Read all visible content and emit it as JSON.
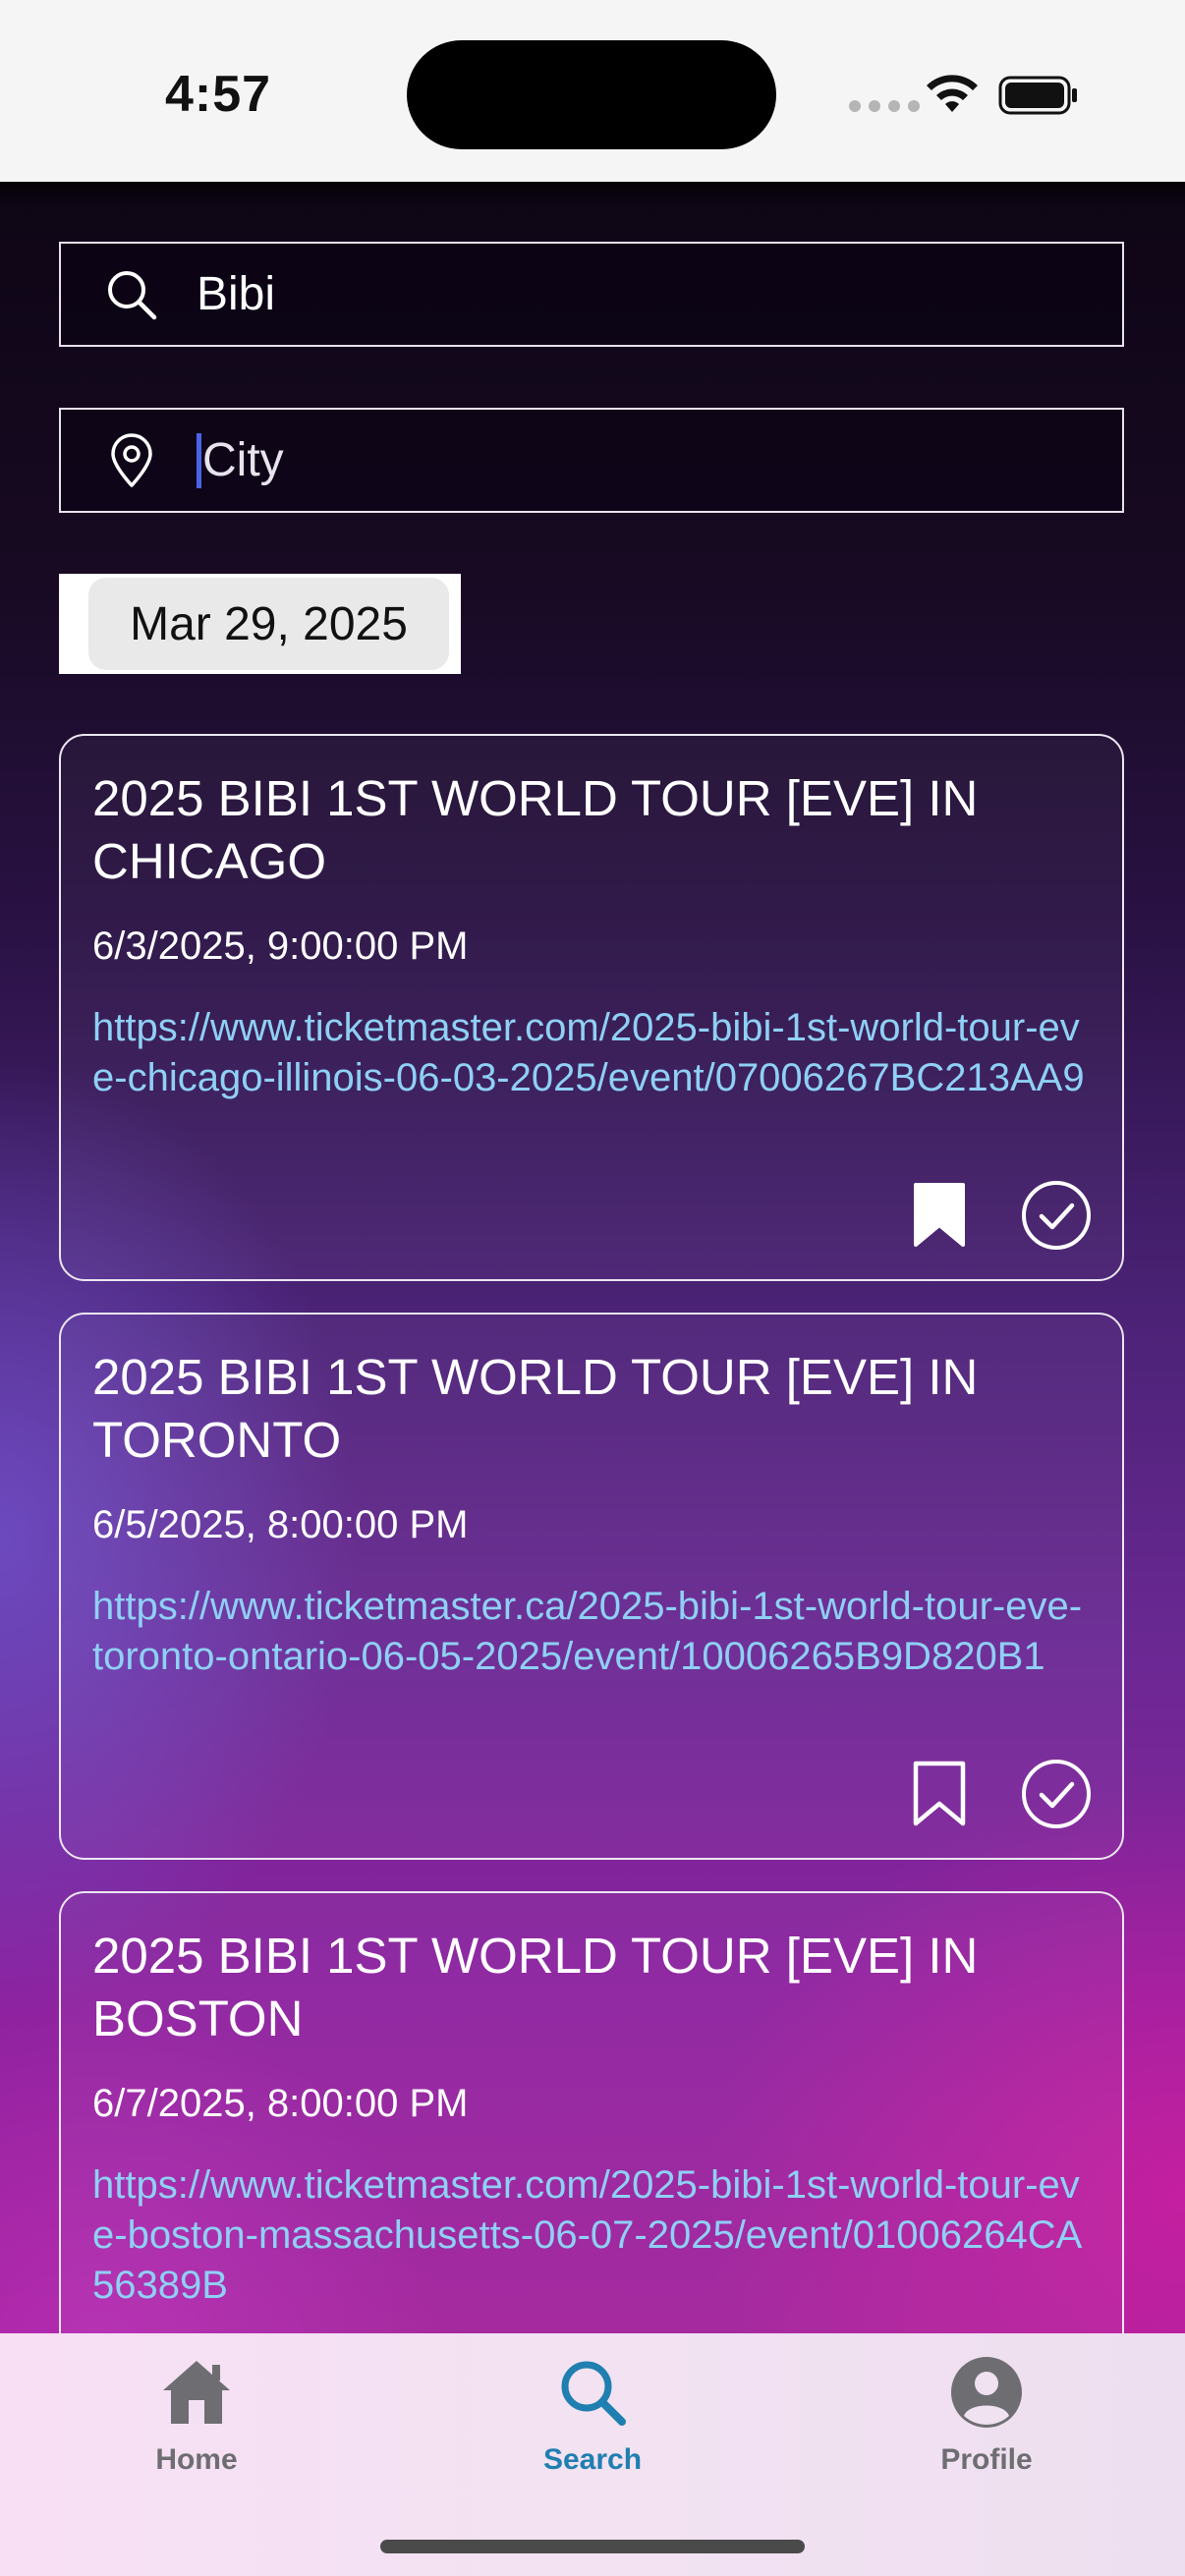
{
  "status_bar": {
    "time": "4:57"
  },
  "search": {
    "query": "Bibi",
    "icon": "search-icon"
  },
  "city": {
    "placeholder": "City",
    "icon": "location-pin-icon"
  },
  "date_picker": {
    "value": "Mar 29, 2025"
  },
  "events": [
    {
      "title": "2025 BIBI 1ST WORLD TOUR [EVE] IN CHICAGO",
      "datetime": "6/3/2025, 9:00:00 PM",
      "url": "https://www.ticketmaster.com/2025-bibi-1st-world-tour-eve-chicago-illinois-06-03-2025/event/07006267BC213AA9",
      "bookmarked": true
    },
    {
      "title": "2025 BIBI 1ST WORLD TOUR [EVE] IN TORONTO",
      "datetime": "6/5/2025, 8:00:00 PM",
      "url": "https://www.ticketmaster.ca/2025-bibi-1st-world-tour-eve-toronto-ontario-06-05-2025/event/10006265B9D820B1",
      "bookmarked": false
    },
    {
      "title": "2025 BIBI 1ST WORLD TOUR [EVE] IN BOSTON",
      "datetime": "6/7/2025, 8:00:00 PM",
      "url": "https://www.ticketmaster.com/2025-bibi-1st-world-tour-eve-boston-massachusetts-06-07-2025/event/01006264CA56389B",
      "bookmarked": false
    }
  ],
  "tab_bar": {
    "home": "Home",
    "search": "Search",
    "profile": "Profile",
    "active": "search"
  },
  "colors": {
    "link": "#8fd0f5",
    "active_tab": "#1f7fb0",
    "inactive_tab": "#6e6e72",
    "caret": "#4a63e8"
  }
}
